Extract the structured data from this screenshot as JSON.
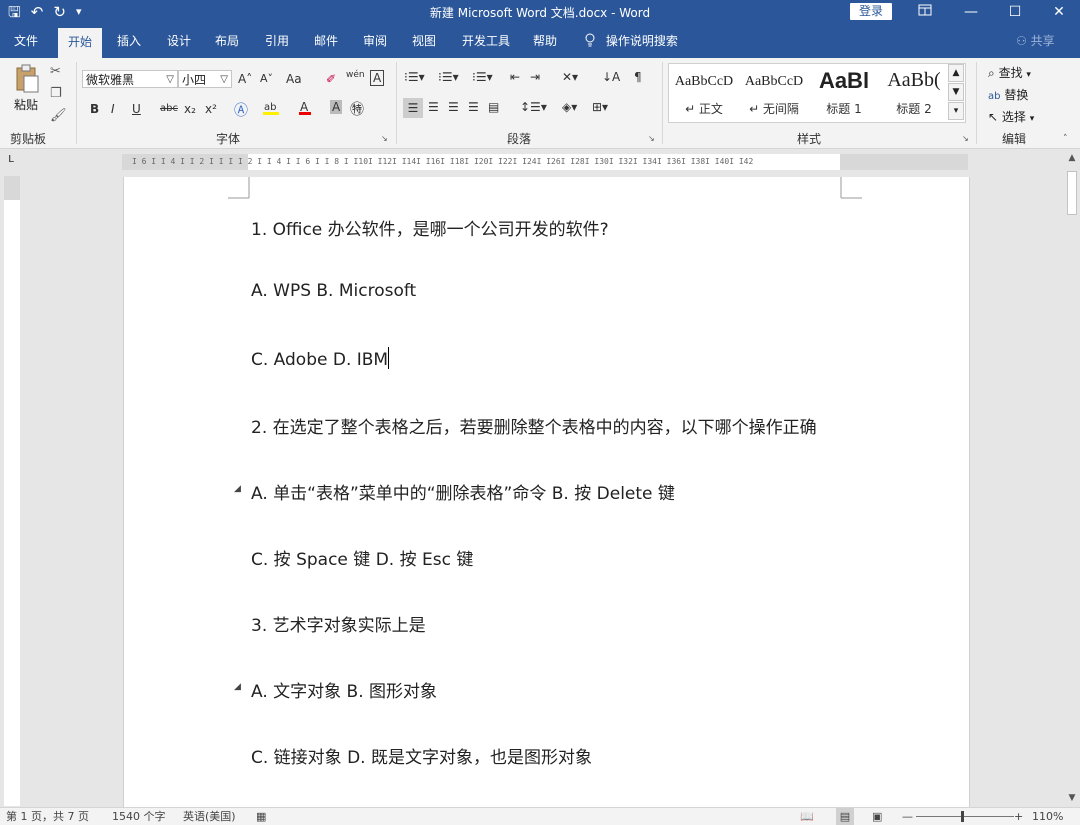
{
  "window": {
    "title": "新建 Microsoft Word 文档.docx  -  Word",
    "login": "登录",
    "minimize": "—",
    "restore": "☐",
    "close": "✕"
  },
  "qat": {
    "save": "🖫",
    "undo": "↶",
    "redo": "↻",
    "more": "▾"
  },
  "tabs": [
    "文件",
    "开始",
    "插入",
    "设计",
    "布局",
    "引用",
    "邮件",
    "审阅",
    "视图",
    "开发工具",
    "帮助"
  ],
  "tell_me": "操作说明搜索",
  "share": "共享",
  "ribbon": {
    "clipboard": {
      "paste": "粘贴",
      "label": "剪贴板"
    },
    "font": {
      "name": "微软雅黑",
      "size": "小四",
      "label": "字体",
      "bold": "B",
      "italic": "I",
      "underline": "U",
      "strike": "abc",
      "sub": "x₂",
      "sup": "x²",
      "grow": "A˄",
      "shrink": "A˅",
      "case": "Aa",
      "clear": "✐",
      "phonetic": "wén",
      "border": "A"
    },
    "paragraph": {
      "label": "段落"
    },
    "styles": {
      "label": "样式",
      "items": [
        {
          "preview": "AaBbCcD",
          "name": "↵ 正文"
        },
        {
          "preview": "AaBbCcD",
          "name": "↵ 无间隔"
        },
        {
          "preview": "AaBl",
          "name": "标题 1"
        },
        {
          "preview": "AaBb(",
          "name": "标题 2"
        }
      ]
    },
    "editing": {
      "find": "查找",
      "replace": "替换",
      "select": "选择",
      "label": "编辑"
    }
  },
  "document": {
    "paragraphs": [
      "1. Office 办公软件，是哪一个公司开发的软件?",
      "A. WPS B. Microsoft",
      "C. Adobe D. IBM",
      "2. 在选定了整个表格之后，若要删除整个表格中的内容，以下哪个操作正确",
      "A. 单击“表格”菜单中的“删除表格”命令 B. 按 Delete 键",
      "C. 按 Space 键 D. 按 Esc 键",
      "3. 艺术字对象实际上是",
      "A. 文字对象 B. 图形对象",
      "C. 链接对象 D. 既是文字对象，也是图形对象"
    ]
  },
  "ruler": {
    "h_text": "I 6 I  I 4 I  I 2 I  I   I  I 2 I  I 4 I  I 6 I  I 8 I  I10I  I12I  I14I  I16I  I18I  I20I  I22I  I24I  I26I  I28I  I30I  I32I  I34I  I36I  I38I  I40I  I42"
  },
  "status": {
    "page": "第 1 页，共 7 页",
    "words": "1540 个字",
    "language": "英语(美国)",
    "zoom": "110%",
    "zoom_minus": "—",
    "zoom_plus": "+"
  }
}
